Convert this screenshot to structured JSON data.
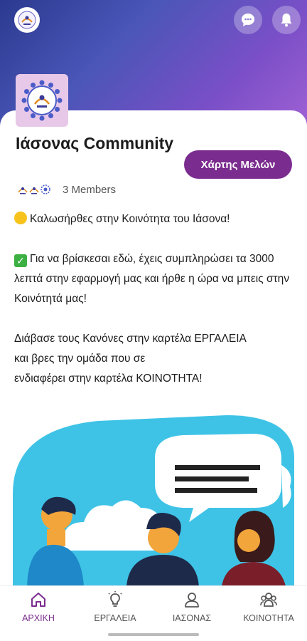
{
  "header": {
    "logo_icon": "community-logo-icon",
    "chat_icon": "chat-bubble-icon",
    "bell_icon": "notification-bell-icon"
  },
  "community": {
    "name": "Ιάσονας Community",
    "members_count_label": "3 Members",
    "map_button_label": "Χάρτης Μελών"
  },
  "description": {
    "line1": "Καλωσήρθες στην Κοινότητα του Ιάσονα!",
    "line2": "Για να βρίσκεσαι εδώ, έχεις συμπληρώσει τα 3000 λεπτά στην εφαρμογή μας και ήρθε η ώρα να μπεις στην Κοινότητά μας!",
    "line3a": "Διάβασε τους Κανόνες στην καρτέλα ΕΡΓΑΛΕΙΑ",
    "line3b": "και βρες την ομάδα που σε",
    "line3c": "ενδιαφέρει στην καρτέλα ΚΟΙΝΟΤΗΤΑ!"
  },
  "nav": {
    "items": [
      {
        "label": "ΑΡΧΙΚΗ",
        "icon": "home-icon",
        "active": true
      },
      {
        "label": "ΕΡΓΑΛΕΙΑ",
        "icon": "lightbulb-icon",
        "active": false
      },
      {
        "label": "ΙΑΣΟΝΑΣ",
        "icon": "person-icon",
        "active": false
      },
      {
        "label": "ΚΟΙΝΟΤΗΤΑ",
        "icon": "group-icon",
        "active": false
      }
    ]
  },
  "colors": {
    "accent": "#7b2c8f",
    "hero_start": "#2b3a8f",
    "hero_end": "#a463d6",
    "illustration_bg": "#3ec3e6"
  }
}
